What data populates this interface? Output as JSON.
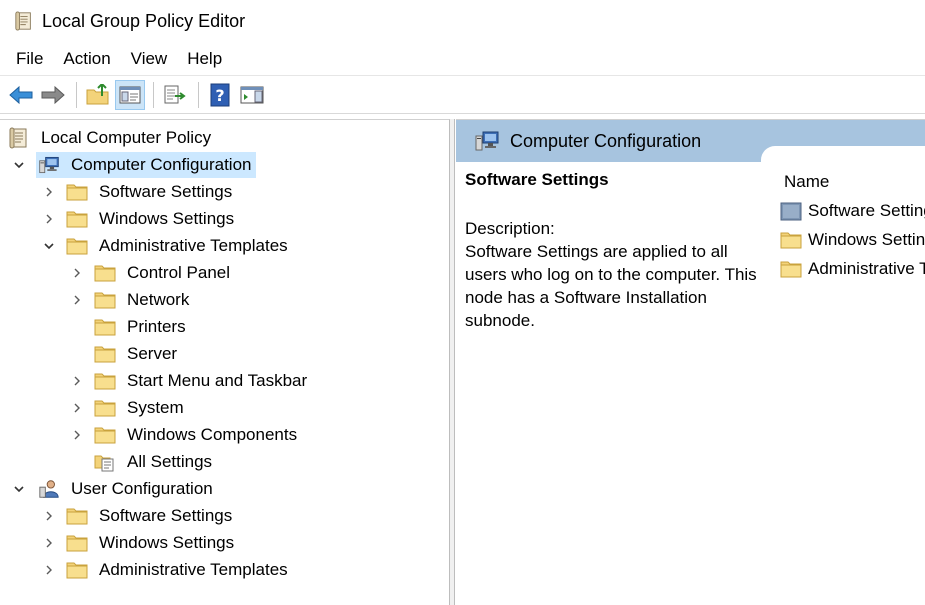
{
  "window": {
    "title": "Local Group Policy Editor"
  },
  "menu": [
    "File",
    "Action",
    "View",
    "Help"
  ],
  "toolbar": {
    "buttons": [
      "back-arrow-icon",
      "forward-arrow-icon",
      "up-folder-icon",
      "show-hide-tree-icon",
      "export-list-icon",
      "help-icon",
      "action-pane-icon"
    ]
  },
  "tree": {
    "root": "Local Computer Policy",
    "computer": "Computer Configuration",
    "computer_children": {
      "software": "Software Settings",
      "windows": "Windows Settings",
      "admin": "Administrative Templates",
      "admin_children": {
        "control_panel": "Control Panel",
        "network": "Network",
        "printers": "Printers",
        "server": "Server",
        "start_menu": "Start Menu and Taskbar",
        "system": "System",
        "windows_components": "Windows Components",
        "all_settings": "All Settings"
      }
    },
    "user": "User Configuration",
    "user_children": {
      "software": "Software Settings",
      "windows": "Windows Settings",
      "admin": "Administrative Templates"
    }
  },
  "details": {
    "header": "Computer Configuration",
    "title": "Software Settings",
    "description_label": "Description:",
    "description_text": "Software Settings are applied to all users who log on to the computer. This node has a Software Installation subnode.",
    "column_name": "Name",
    "items": [
      "Software Settings",
      "Windows Settings",
      "Administrative Templates"
    ]
  },
  "colors": {
    "selection": "#cce8ff",
    "header": "#a7c4df",
    "folder": "#f3d37a"
  }
}
